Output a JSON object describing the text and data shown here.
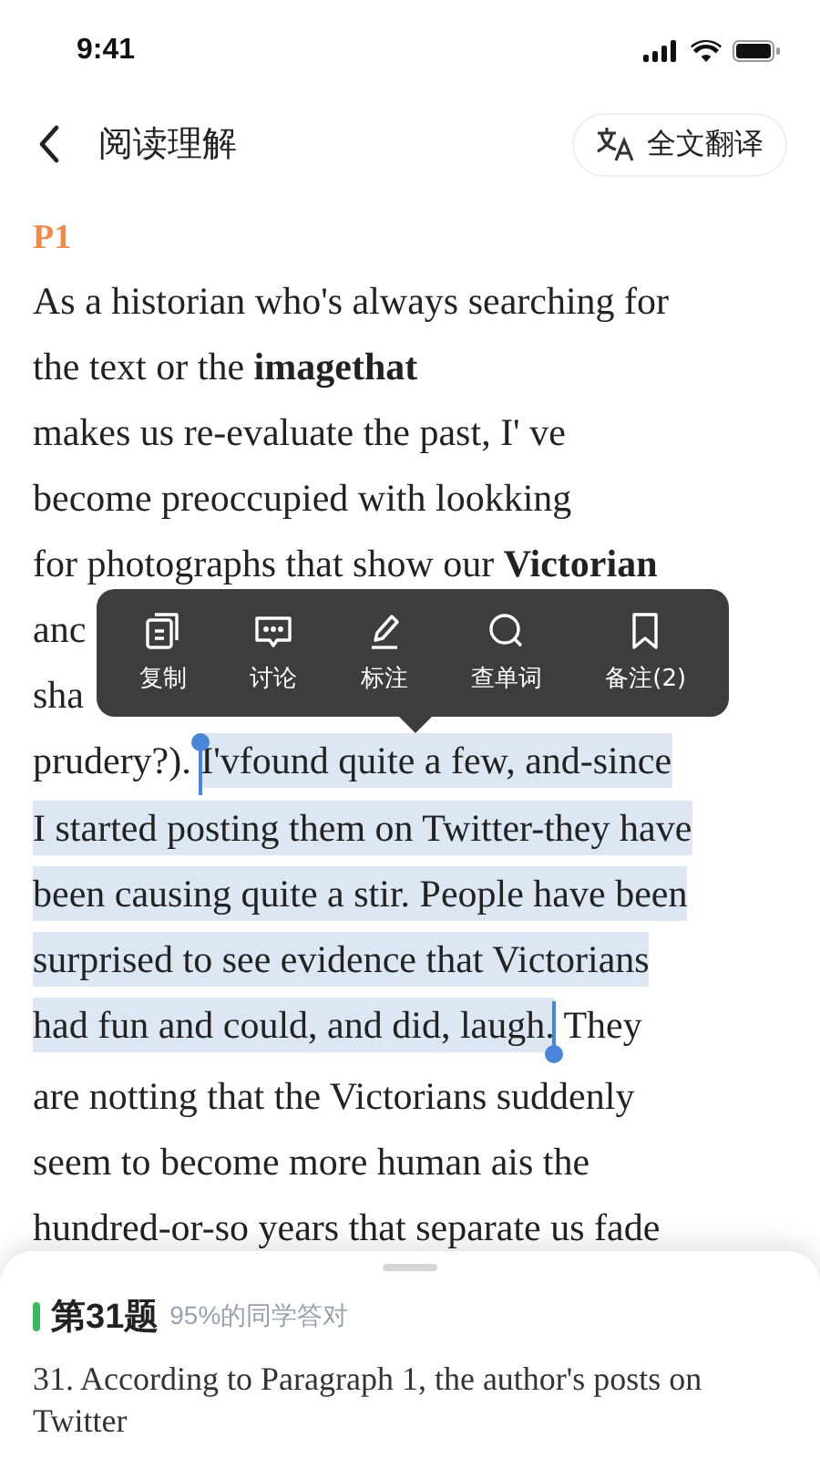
{
  "status_bar": {
    "time": "9:41"
  },
  "nav": {
    "title": "阅读理解",
    "translate_button": "全文翻译"
  },
  "passage": {
    "heading": "P1",
    "lines": [
      {
        "segments": [
          {
            "text": "As a historian who's always searching for",
            "highlighted": false
          }
        ]
      },
      {
        "segments": [
          {
            "text": "the text or the **imagethat**",
            "highlighted": false
          }
        ]
      },
      {
        "segments": [
          {
            "text": "makes us re-evaluate the past, I' ve",
            "highlighted": false
          }
        ]
      },
      {
        "segments": [
          {
            "text": "become preoccupied with lookking",
            "highlighted": false
          }
        ]
      },
      {
        "segments": [
          {
            "text": "for photographs that show our **Victorian**",
            "highlighted": false
          }
        ]
      },
      {
        "segments": [
          {
            "text": "anc",
            "highlighted": false
          }
        ]
      },
      {
        "segments": [
          {
            "text": "sha",
            "highlighted": false
          }
        ]
      },
      {
        "segments": [
          {
            "text": "prudery?). ",
            "highlighted": false
          },
          {
            "text": "I'vfound quite a few, and-since",
            "highlighted": true
          }
        ]
      },
      {
        "segments": [
          {
            "text": "I started posting them on Twitter-they have",
            "highlighted": true
          }
        ]
      },
      {
        "segments": [
          {
            "text": "been causing quite a stir. People have been",
            "highlighted": true
          }
        ]
      },
      {
        "segments": [
          {
            "text": "surprised to see evidence that Victorians",
            "highlighted": true
          }
        ]
      },
      {
        "segments": [
          {
            "text": "had fun and could, and did, laugh.",
            "highlighted": true
          },
          {
            "text": " They",
            "highlighted": false
          }
        ]
      },
      {
        "segments": [
          {
            "text": "are notting that the Victorians suddenly",
            "highlighted": false
          }
        ]
      },
      {
        "segments": [
          {
            "text": "seem to become more human ais the",
            "highlighted": false
          }
        ]
      },
      {
        "segments": [
          {
            "text": "hundred-or-so years that separate us fade",
            "highlighted": false
          }
        ]
      }
    ]
  },
  "selection_menu": {
    "items": [
      {
        "kind": "copy",
        "label": "复制"
      },
      {
        "kind": "discuss",
        "label": "讨论"
      },
      {
        "kind": "mark",
        "label": "标注"
      },
      {
        "kind": "lookup",
        "label": "查单词"
      },
      {
        "kind": "note",
        "label": "备注(2)"
      }
    ]
  },
  "question_sheet": {
    "title": "第31题",
    "stat": "95%的同学答对",
    "question": "31. According to Paragraph 1, the author's posts on Twitter"
  }
}
